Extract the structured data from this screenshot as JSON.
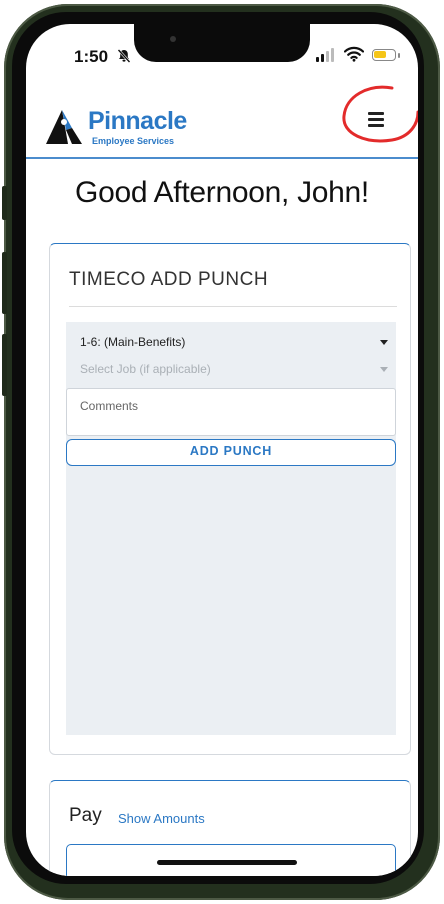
{
  "status_bar": {
    "time": "1:50",
    "icons": [
      "bell-slash-icon",
      "cellular-signal-icon",
      "wifi-icon",
      "battery-icon"
    ],
    "battery_color": "#f5c518"
  },
  "header": {
    "logo_name": "Pinnacle",
    "logo_subtitle": "Employee Services",
    "brand_color": "#2b78c4",
    "menu_icon": "hamburger-menu-icon",
    "highlight_color": "#e32b2b"
  },
  "greeting": "Good Afternoon, John!",
  "timeco": {
    "title": "TIMECO ADD PUNCH",
    "position_select": "1-6: (Main-Benefits)",
    "job_select_placeholder": "Select Job (if applicable)",
    "comments_placeholder": "Comments",
    "add_punch_label": "ADD PUNCH"
  },
  "pay": {
    "title": "Pay",
    "show_amounts_label": "Show Amounts"
  }
}
